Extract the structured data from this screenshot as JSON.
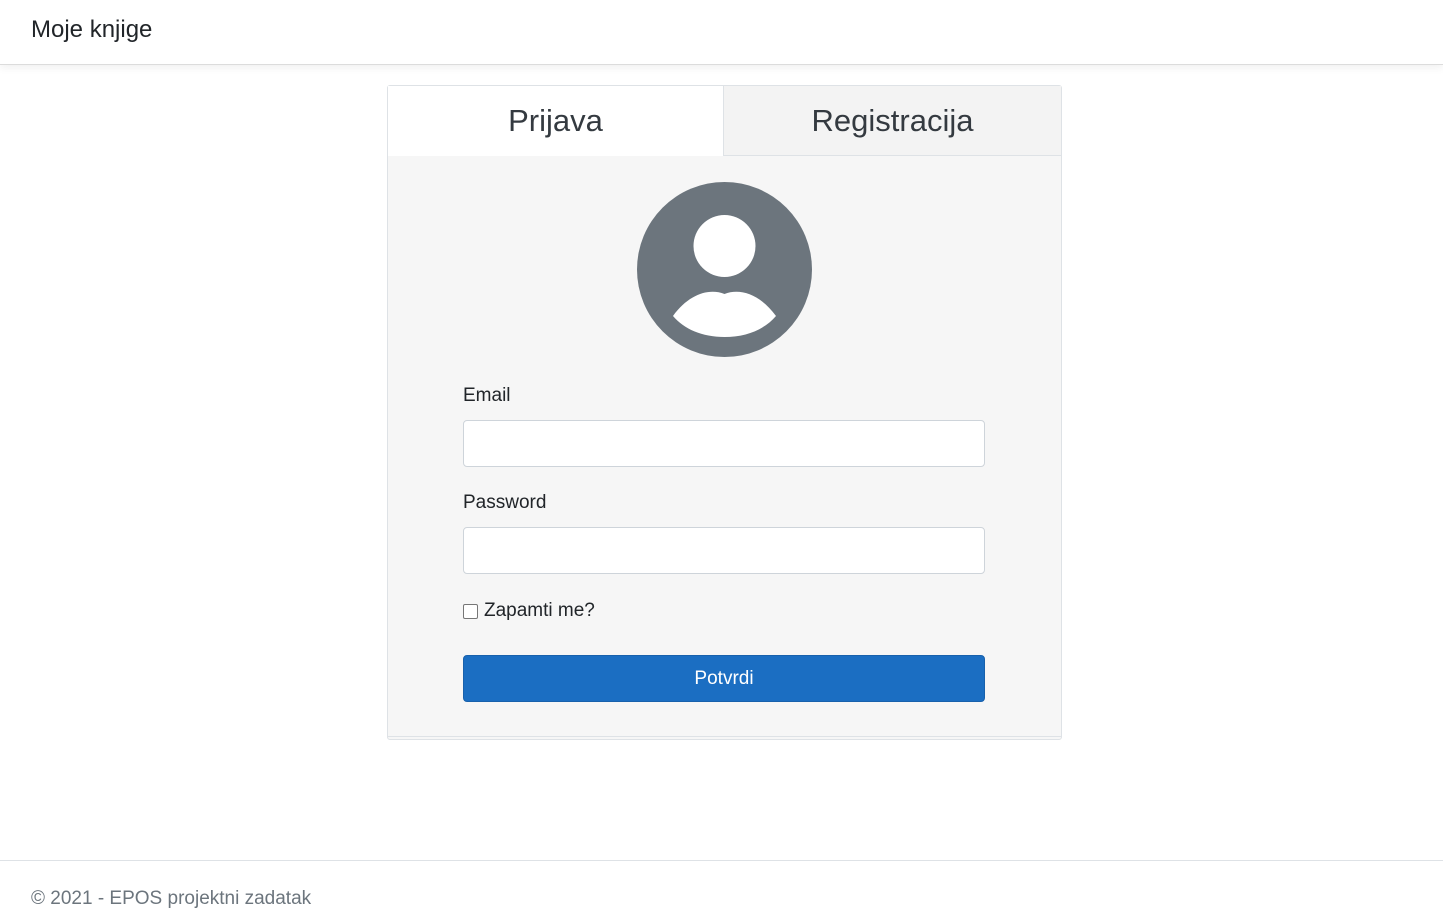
{
  "navbar": {
    "brand": "Moje knjige"
  },
  "tabs": [
    {
      "label": "Prijava",
      "active": true
    },
    {
      "label": "Registracija",
      "active": false
    }
  ],
  "avatar": {
    "icon": "user-avatar-icon",
    "color": "#6c757d"
  },
  "form": {
    "email_label": "Email",
    "email_value": "",
    "password_label": "Password",
    "password_value": "",
    "remember_label": "Zapamti me?",
    "remember_checked": false,
    "submit_label": "Potvrdi"
  },
  "footer": {
    "text": "© 2021 - EPOS projektni zadatak"
  },
  "colors": {
    "primary": "#1b6ec2",
    "avatar": "#6c757d",
    "card_bg": "#f6f6f6"
  }
}
